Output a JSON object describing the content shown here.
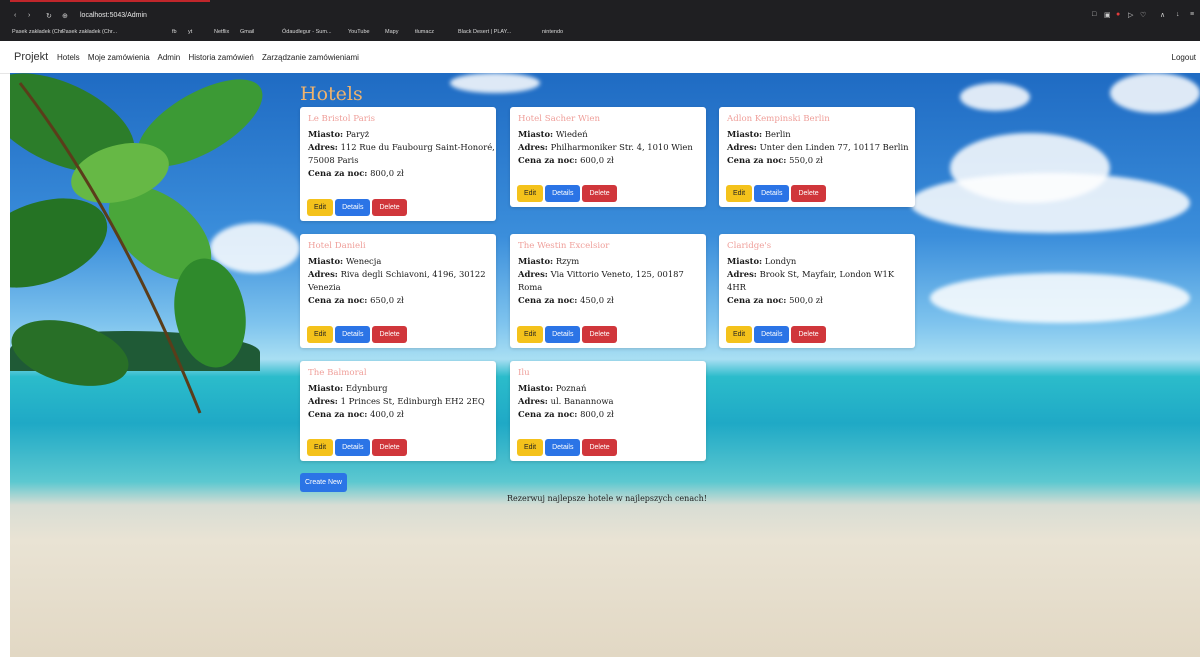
{
  "browser": {
    "url": "localhost:5043/Admin",
    "bookmarks": [
      "Pasek zakładek (Chr...",
      "Pasek zakładek (Chr...",
      "fb",
      "yt",
      "Netflix",
      "Gmail",
      "Ódaudlegur - Sum...",
      "YouTube",
      "Mapy",
      "tłumacz",
      "Black Desert | PLAY...",
      "nintendo"
    ]
  },
  "nav": {
    "brand": "Projekt",
    "links": [
      "Hotels",
      "Moje zamówienia",
      "Admin",
      "Historia zamówień",
      "Zarządzanie zamówieniami"
    ],
    "logout": "Logout"
  },
  "page": {
    "heading": "Hotels",
    "create_label": "Create New",
    "footer": "Rezerwuj najlepsze hotele w najlepszych cenach!"
  },
  "labels": {
    "city": "Miasto:",
    "address": "Adres:",
    "price": "Cena za noc:",
    "edit": "Edit",
    "details": "Details",
    "delete": "Delete"
  },
  "hotels": [
    {
      "name": "Le Bristol Paris",
      "city": "Paryż",
      "address": "112 Rue du Faubourg Saint-Honoré, 75008 Paris",
      "price": "800,0 zł"
    },
    {
      "name": "Hotel Sacher Wien",
      "city": "Wiedeń",
      "address": "Philharmoniker Str. 4, 1010 Wien",
      "price": "600,0 zł"
    },
    {
      "name": "Adlon Kempinski Berlin",
      "city": "Berlin",
      "address": "Unter den Linden 77, 10117 Berlin",
      "price": "550,0 zł"
    },
    {
      "name": "Hotel Danieli",
      "city": "Wenecja",
      "address": "Riva degli Schiavoni, 4196, 30122 Venezia",
      "price": "650,0 zł"
    },
    {
      "name": "The Westin Excelsior",
      "city": "Rzym",
      "address": "Via Vittorio Veneto, 125, 00187 Roma",
      "price": "450,0 zł"
    },
    {
      "name": "Claridge's",
      "city": "Londyn",
      "address": "Brook St, Mayfair, London W1K 4HR",
      "price": "500,0 zł"
    },
    {
      "name": "The Balmoral",
      "city": "Edynburg",
      "address": "1 Princes St, Edinburgh EH2 2EQ",
      "price": "400,0 zł"
    },
    {
      "name": "Ilu",
      "city": "Poznań",
      "address": "ul. Banannowa",
      "price": "800,0 zł"
    }
  ]
}
